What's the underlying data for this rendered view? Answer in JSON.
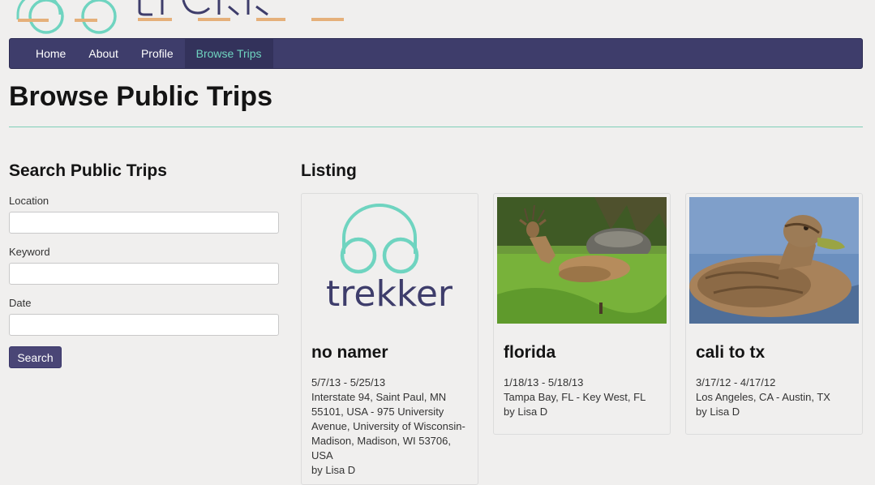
{
  "brand": {
    "name": "trekker",
    "color_teal": "#6fd4c0",
    "color_navy": "#3e3d6b",
    "color_orange": "#e5b07a"
  },
  "nav": {
    "items": [
      {
        "label": "Home"
      },
      {
        "label": "About"
      },
      {
        "label": "Profile"
      },
      {
        "label": "Browse Trips",
        "active": true
      }
    ]
  },
  "page": {
    "title": "Browse Public Trips"
  },
  "search": {
    "heading": "Search Public Trips",
    "location_label": "Location",
    "location_value": "",
    "keyword_label": "Keyword",
    "keyword_value": "",
    "date_label": "Date",
    "date_value": "",
    "button_label": "Search"
  },
  "listing": {
    "heading": "Listing",
    "trips": [
      {
        "title": "no namer",
        "dates": "5/7/13 - 5/25/13",
        "route": "Interstate 94, Saint Paul, MN 55101, USA - 975 University Avenue, University of Wisconsin-Madison, Madison, WI 53706, USA",
        "author": "by Lisa D",
        "image": "trekker-logo"
      },
      {
        "title": "florida",
        "dates": "1/18/13 - 5/18/13",
        "route": "Tampa Bay, FL - Key West, FL",
        "author": "by Lisa D",
        "image": "deer-photo"
      },
      {
        "title": "cali to tx",
        "dates": "3/17/12 - 4/17/12",
        "route": "Los Angeles, CA - Austin, TX",
        "author": "by Lisa D",
        "image": "duck-photo"
      }
    ]
  }
}
